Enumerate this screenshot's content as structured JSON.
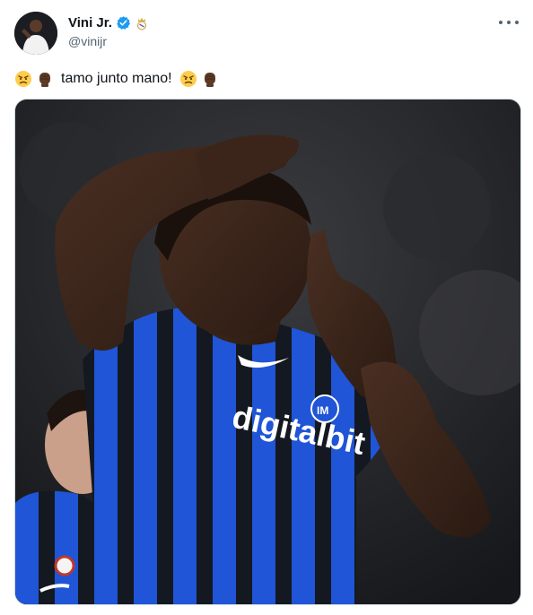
{
  "author": {
    "display_name": "Vini Jr.",
    "handle": "@vinijr",
    "verified_icon": "verified-badge-icon",
    "affiliation_icon": "real-madrid-crest-icon",
    "avatar_icon": "profile-avatar"
  },
  "menu": {
    "icon": "more-options-icon"
  },
  "tweet": {
    "text": "tamo junto mano!",
    "leading_emojis": [
      "angry-face-emoji",
      "raised-fist-emoji"
    ],
    "trailing_emojis": [
      "angry-face-emoji",
      "raised-fist-emoji"
    ]
  },
  "media": {
    "description_icon": "tweet-photo",
    "jersey_sponsor": "digitalbit"
  },
  "colors": {
    "verified_blue": "#1d9bf0",
    "jersey_blue": "#1f55d6",
    "jersey_black": "#141820",
    "text_primary": "#0f1419",
    "text_secondary": "#536471"
  }
}
